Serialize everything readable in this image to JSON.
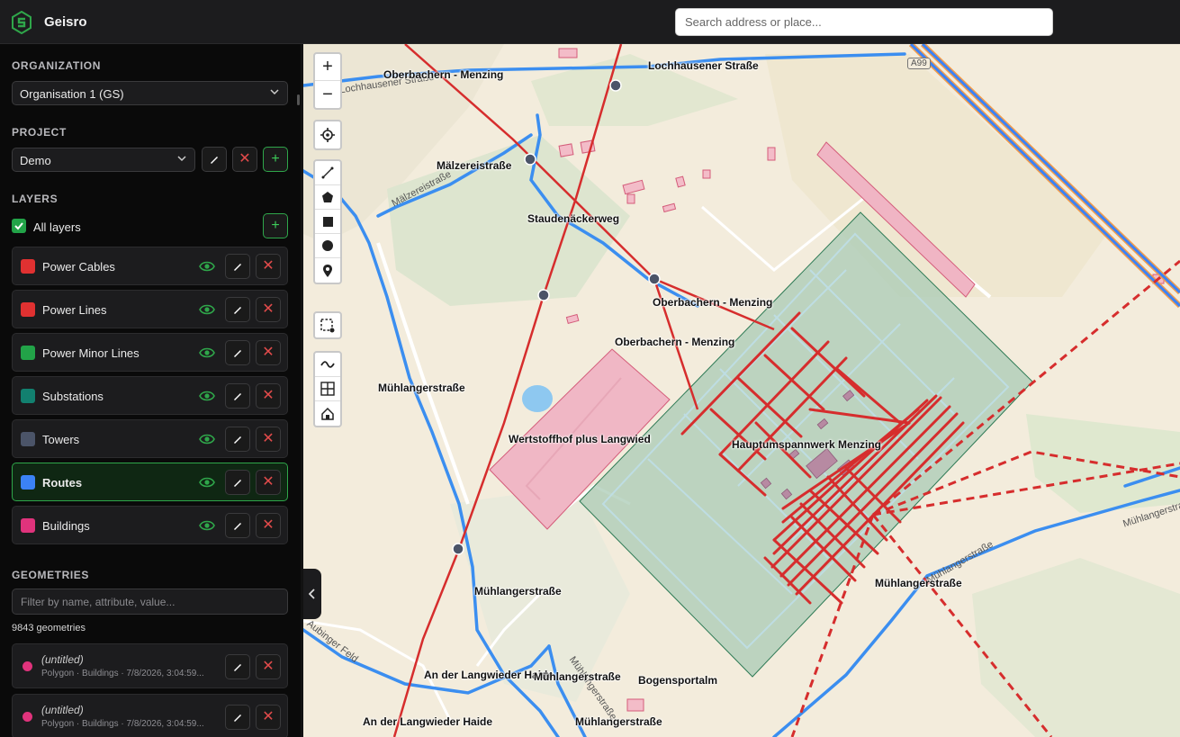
{
  "app": {
    "title": "Geisro"
  },
  "search": {
    "placeholder": "Search address or place..."
  },
  "sidebar": {
    "organization": {
      "heading": "ORGANIZATION",
      "selected": "Organisation 1 (GS)"
    },
    "project": {
      "heading": "PROJECT",
      "selected": "Demo"
    },
    "layers": {
      "heading": "LAYERS",
      "all_label": "All layers",
      "items": [
        {
          "label": "Power Cables",
          "color": "#e03131",
          "active": false
        },
        {
          "label": "Power Lines",
          "color": "#e03131",
          "active": false
        },
        {
          "label": "Power Minor Lines",
          "color": "#22a348",
          "active": false
        },
        {
          "label": "Substations",
          "color": "#12806f",
          "active": false
        },
        {
          "label": "Towers",
          "color": "#4b5468",
          "active": false
        },
        {
          "label": "Routes",
          "color": "#3b82f6",
          "active": true
        },
        {
          "label": "Buildings",
          "color": "#e0337c",
          "active": false
        }
      ]
    },
    "geometries": {
      "heading": "GEOMETRIES",
      "filter_placeholder": "Filter by name, attribute, value...",
      "count": "9843 geometries",
      "items": [
        {
          "title": "(untitled)",
          "subtitle": "Polygon · Buildings · 7/8/2026, 3:04:59..."
        },
        {
          "title": "(untitled)",
          "subtitle": "Polygon · Buildings · 7/8/2026, 3:04:59..."
        }
      ]
    }
  },
  "map": {
    "labels": [
      "Oberbachern - Menzing",
      "Lochhausener Straße",
      "Mälzereistraße",
      "Staudenäckerweg",
      "Oberbachern - Menzing",
      "Oberbachern - Menzing",
      "Mühlangerstraße",
      "Wertstoffhof plus Langwied",
      "Hauptumspannwerk Menzing",
      "Mühlangerstraße",
      "Mühlangerstraße",
      "An der Langwieder Haide",
      "Mühlangerstraße",
      "Bogensportalm",
      "An der Langwieder Haide",
      "Mühlangerstraße"
    ],
    "road_labels": [
      "Lochhausener Straße",
      "Mälzereistraße",
      "Aubinger Feld",
      "Mühlangerstraße",
      "Mühlangerstraße",
      "Mühlangerstraße",
      "A99"
    ]
  },
  "toolbar": {
    "zoom_in": "+",
    "zoom_out": "−",
    "icons": [
      "locate-icon",
      "line-icon",
      "polygon-icon",
      "rectangle-icon",
      "circle-icon",
      "marker-icon",
      "select-icon",
      "route-icon",
      "split-icon",
      "home-icon"
    ]
  }
}
